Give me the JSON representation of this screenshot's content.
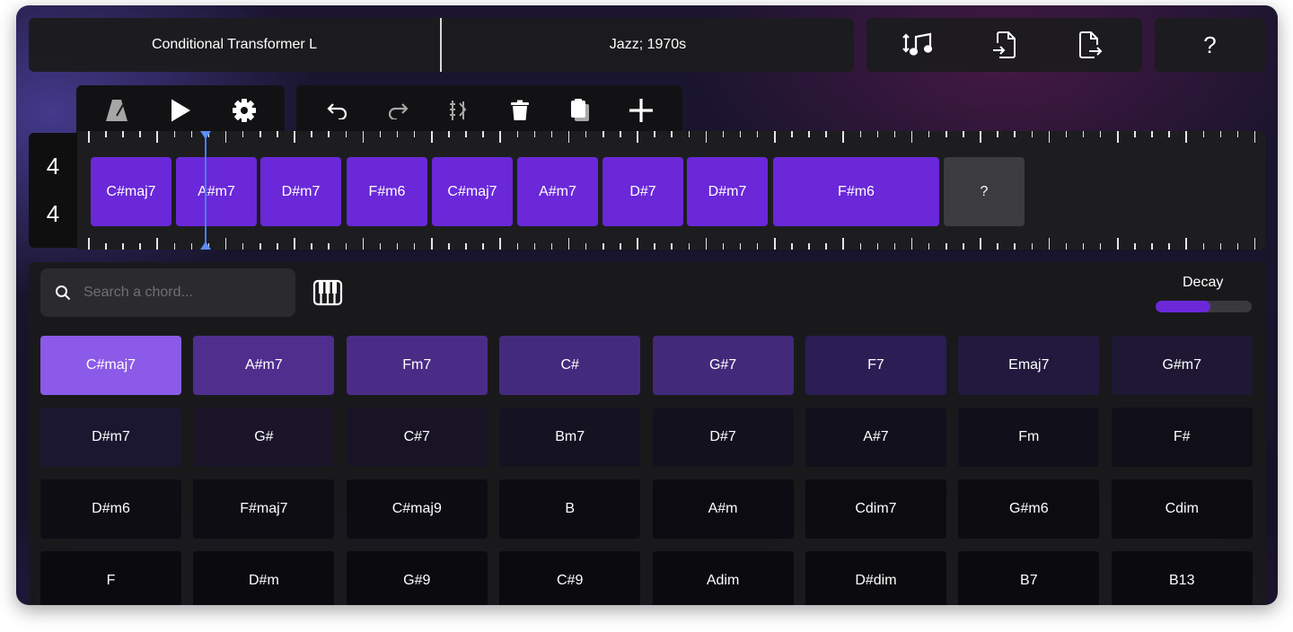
{
  "header": {
    "model": "Conditional Transformer L",
    "style": "Jazz; 1970s",
    "help": "?"
  },
  "header_actions": [
    {
      "name": "transpose-music-icon",
      "label": "transpose"
    },
    {
      "name": "import-file-icon",
      "label": "import"
    },
    {
      "name": "export-file-icon",
      "label": "export"
    }
  ],
  "transport": [
    "metronome-icon",
    "play-icon",
    "settings-gear-icon"
  ],
  "edit_tools": [
    "undo-icon",
    "redo-icon",
    "regenerate-icon",
    "delete-icon",
    "paste-icon",
    "add-icon"
  ],
  "time_signature": {
    "top": "4",
    "bottom": "4"
  },
  "timeline": {
    "chords": [
      {
        "label": "C#maj7"
      },
      {
        "label": "A#m7"
      },
      {
        "label": "D#m7"
      },
      {
        "label": "F#m6"
      },
      {
        "label": "C#maj7"
      },
      {
        "label": "A#m7"
      },
      {
        "label": "D#7"
      },
      {
        "label": "D#m7"
      },
      {
        "label": "F#m6"
      },
      {
        "label": "?",
        "empty": true
      }
    ]
  },
  "search": {
    "placeholder": "Search a chord..."
  },
  "decay": {
    "label": "Decay",
    "value": 0.57
  },
  "suggestions": [
    {
      "label": "C#maj7",
      "color": "#8b5ae8"
    },
    {
      "label": "A#m7",
      "color": "#4f2e8e"
    },
    {
      "label": "Fm7",
      "color": "#4a2c86"
    },
    {
      "label": "C#",
      "color": "#442a7c"
    },
    {
      "label": "G#7",
      "color": "#42297a"
    },
    {
      "label": "F7",
      "color": "#2c1d55"
    },
    {
      "label": "Emaj7",
      "color": "#221a3e"
    },
    {
      "label": "G#m7",
      "color": "#1e1834"
    },
    {
      "label": "D#m7",
      "color": "#1c1730"
    },
    {
      "label": "G#",
      "color": "#1a1529"
    },
    {
      "label": "C#7",
      "color": "#181425"
    },
    {
      "label": "Bm7",
      "color": "#151222"
    },
    {
      "label": "D#7",
      "color": "#14111f"
    },
    {
      "label": "A#7",
      "color": "#12101c"
    },
    {
      "label": "Fm",
      "color": "#110f19"
    },
    {
      "label": "F#",
      "color": "#100e17"
    },
    {
      "label": "D#m6",
      "color": "#0e0d14"
    },
    {
      "label": "F#maj7",
      "color": "#0e0d13"
    },
    {
      "label": "C#maj9",
      "color": "#0d0c12"
    },
    {
      "label": "B",
      "color": "#0d0c12"
    },
    {
      "label": "A#m",
      "color": "#0c0b11"
    },
    {
      "label": "Cdim7",
      "color": "#0c0b10"
    },
    {
      "label": "G#m6",
      "color": "#0c0b10"
    },
    {
      "label": "Cdim",
      "color": "#0c0b10"
    },
    {
      "label": "F",
      "color": "#0b0a0f"
    },
    {
      "label": "D#m",
      "color": "#0b0a0f"
    },
    {
      "label": "G#9",
      "color": "#0b0a0f"
    },
    {
      "label": "C#9",
      "color": "#0b0a0f"
    },
    {
      "label": "Adim",
      "color": "#0b0a0f"
    },
    {
      "label": "D#dim",
      "color": "#0b0a0f"
    },
    {
      "label": "B7",
      "color": "#0b0a0f"
    },
    {
      "label": "B13",
      "color": "#0b0a0f"
    }
  ]
}
